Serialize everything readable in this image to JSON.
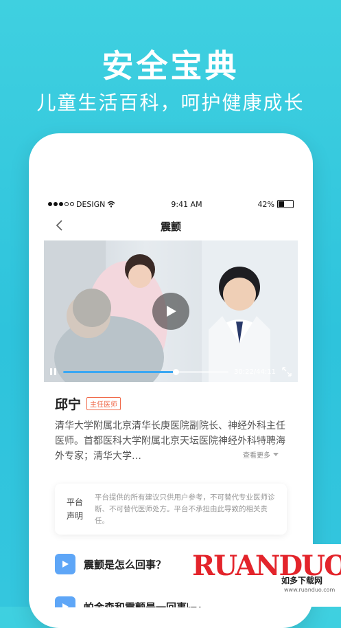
{
  "hero": {
    "title": "安全宝典",
    "subtitle": "儿童生活百科，呵护健康成长"
  },
  "status_bar": {
    "carrier": "DESIGN",
    "time": "9:41 AM",
    "battery": "42%"
  },
  "nav": {
    "title": "震颤",
    "back_icon": "chevron-left-icon"
  },
  "video": {
    "time": "30:22/44:11",
    "progress": 0.68
  },
  "doctor": {
    "name": "邱宁",
    "badge": "主任医师",
    "description": "清华大学附属北京清华长庚医院副院长、神经外科主任医师。首都医科大学附属北京天坛医院神经外科特聘海外专家；清华大学…",
    "see_more": "查看更多"
  },
  "disclaimer": {
    "label_line1": "平台",
    "label_line2": "声明",
    "text": "平台提供的所有建议只供用户参考，不可替代专业医师诊断、不可替代医师处方。平台不承担由此导致的相关责任。"
  },
  "qa": [
    {
      "text": "震颤是怎么回事？"
    },
    {
      "text": "帕金森和震颤是一回事吗？"
    }
  ],
  "watermark": {
    "brand": "RUANDUO",
    "cn": "如多下载网",
    "url": "www.ruanduo.com"
  },
  "colors": {
    "background": "#2ec3dc",
    "accent": "#3aa7f2",
    "badge": "#f06a4a"
  }
}
